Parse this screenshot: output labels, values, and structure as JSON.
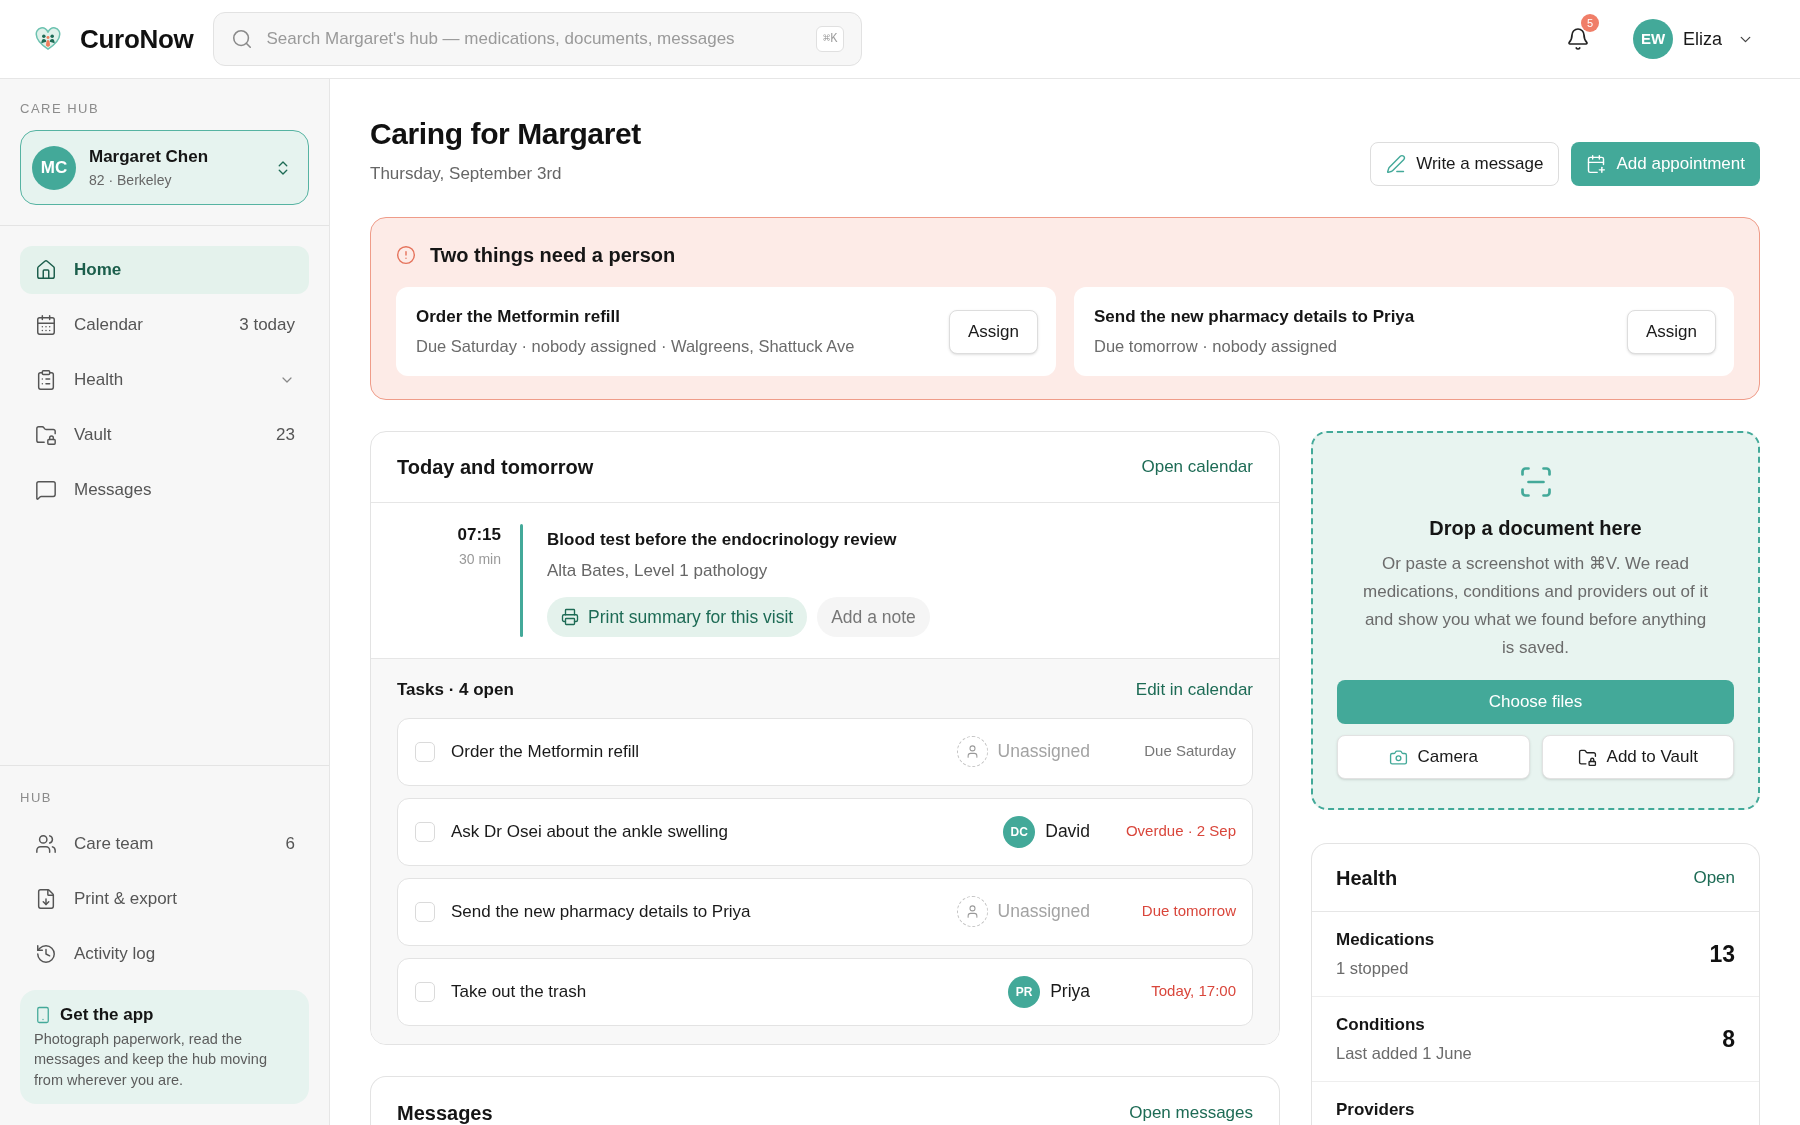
{
  "header": {
    "logo": "CuroNow",
    "search": {
      "placeholder": "Search Margaret's hub — medications, documents, messages",
      "shortcut": "⌘K"
    },
    "notifications": {
      "badge": "5"
    },
    "user": {
      "initials": "EW",
      "name": "Eliza"
    }
  },
  "sidebar": {
    "care_hub": {
      "label": "CARE HUB",
      "patient": {
        "initials": "MC",
        "name": "Margaret Chen",
        "detail": "82 · Berkeley"
      },
      "items": [
        {
          "label": "Home",
          "selected": true
        },
        {
          "label": "Calendar",
          "selected": false,
          "count": "3 today"
        },
        {
          "label": "Health",
          "selected": false,
          "expanded": false
        },
        {
          "label": "Vault",
          "selected": false,
          "count": "23"
        },
        {
          "label": "Messages",
          "selected": false
        }
      ]
    },
    "hub": {
      "label": "HUB",
      "items": [
        {
          "label": "Care team",
          "selected": false,
          "count": "6"
        },
        {
          "label": "Print & export",
          "selected": false
        },
        {
          "label": "Activity log",
          "selected": false
        }
      ]
    },
    "promo": {
      "title": "Get the app",
      "text": "Photograph paperwork, read the messages and keep the hub moving from wherever you are."
    }
  },
  "page": {
    "title": "Caring for Margaret",
    "date": "Thursday, September 3rd",
    "actions": [
      {
        "label": "Write a message",
        "kind": "secondary"
      },
      {
        "label": "Add appointment",
        "kind": "primary"
      }
    ]
  },
  "alert": {
    "title": "Two things need a person",
    "items": [
      {
        "title": "Order the Metformin refill",
        "detail": "Due Saturday · nobody assigned · Walgreens, Shattuck Ave",
        "action": "Assign"
      },
      {
        "title": "Send the new pharmacy details to Priya",
        "detail": "Due tomorrow · nobody assigned",
        "action": "Assign"
      }
    ]
  },
  "schedule": {
    "title": "Today and tomorrow",
    "link": "Open calendar",
    "events": [
      {
        "time": "07:15",
        "duration": "30 min",
        "title": "Blood test before the endocrinology review",
        "location": "Alta Bates, Level 1 pathology",
        "actions": [
          {
            "label": "Print summary for this visit",
            "kind": "primary"
          },
          {
            "label": "Add a note",
            "kind": "secondary"
          }
        ]
      }
    ]
  },
  "tasks": {
    "title": "Tasks · 4 open",
    "link": "Edit in calendar",
    "rows": [
      {
        "label": "Order the Metformin refill",
        "checked": false,
        "assignee": {
          "kind": "none",
          "name": "Unassigned"
        },
        "due": "Due Saturday",
        "urgent": false
      },
      {
        "label": "Ask Dr Osei about the ankle swelling",
        "checked": false,
        "assignee": {
          "kind": "person",
          "initials": "DC",
          "name": "David"
        },
        "due": "Overdue · 2 Sep",
        "urgent": true
      },
      {
        "label": "Send the new pharmacy details to Priya",
        "checked": false,
        "assignee": {
          "kind": "none",
          "name": "Unassigned"
        },
        "due": "Due tomorrow",
        "urgent": true
      },
      {
        "label": "Take out the trash",
        "checked": false,
        "assignee": {
          "kind": "person",
          "initials": "PR",
          "name": "Priya"
        },
        "due": "Today, 17:00",
        "urgent": true
      }
    ]
  },
  "messages": {
    "title": "Messages",
    "link": "Open messages"
  },
  "dropzone": {
    "title": "Drop a document here",
    "text": "Or paste a screenshot with ⌘V. We read medications, conditions and providers out of it and show you what we found before anything is saved.",
    "actions": [
      {
        "label": "Choose files",
        "kind": "primary"
      },
      {
        "label": "Camera",
        "kind": "secondary"
      },
      {
        "label": "Add to Vault",
        "kind": "secondary"
      }
    ]
  },
  "health": {
    "title": "Health",
    "link": "Open",
    "rows": [
      {
        "label": "Medications",
        "detail": "1 stopped",
        "value": "13"
      },
      {
        "label": "Conditions",
        "detail": "Last added 1 June",
        "value": "8"
      },
      {
        "label": "Providers"
      }
    ]
  }
}
